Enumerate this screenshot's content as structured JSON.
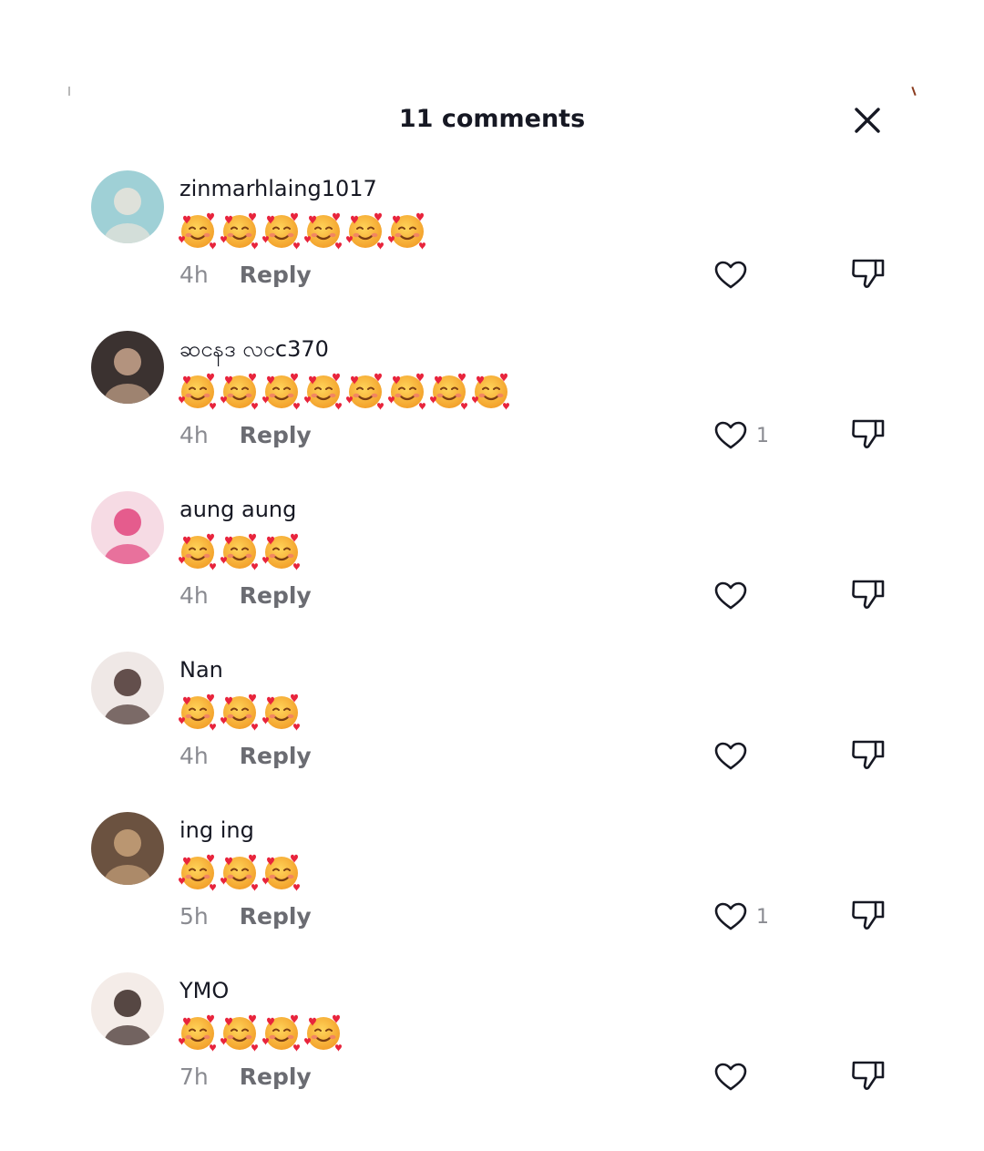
{
  "panel": {
    "title": "11 comments",
    "close_icon": "close-icon"
  },
  "comments": [
    {
      "username": "zinmarhlaing1017",
      "emoji_count": 6,
      "emoji": "smiling-face-with-hearts",
      "time": "4h",
      "reply_label": "Reply",
      "likes": "",
      "avatar_colors": [
        "#9fd0d6",
        "#e9e4da"
      ]
    },
    {
      "username": "ဆငနဒ လငc370",
      "emoji_count": 8,
      "emoji": "smiling-face-with-hearts",
      "time": "4h",
      "reply_label": "Reply",
      "likes": "1",
      "avatar_colors": [
        "#3b3230",
        "#c9a58c"
      ]
    },
    {
      "username": "aung aung",
      "emoji_count": 3,
      "emoji": "smiling-face-with-hearts",
      "time": "4h",
      "reply_label": "Reply",
      "likes": "",
      "avatar_colors": [
        "#f6dbe4",
        "#e2457e"
      ]
    },
    {
      "username": "Nan",
      "emoji_count": 3,
      "emoji": "smiling-face-with-hearts",
      "time": "4h",
      "reply_label": "Reply",
      "likes": "",
      "avatar_colors": [
        "#efe8e6",
        "#4a3430"
      ]
    },
    {
      "username": "ing ing",
      "emoji_count": 3,
      "emoji": "smiling-face-with-hearts",
      "time": "5h",
      "reply_label": "Reply",
      "likes": "1",
      "avatar_colors": [
        "#6b5240",
        "#c8a27a"
      ]
    },
    {
      "username": "YMO",
      "emoji_count": 4,
      "emoji": "smiling-face-with-hearts",
      "time": "7h",
      "reply_label": "Reply",
      "likes": "",
      "avatar_colors": [
        "#f4ece8",
        "#3a2a26"
      ]
    }
  ],
  "icons": {
    "like": "heart-outline-icon",
    "dislike": "thumbs-down-icon"
  }
}
